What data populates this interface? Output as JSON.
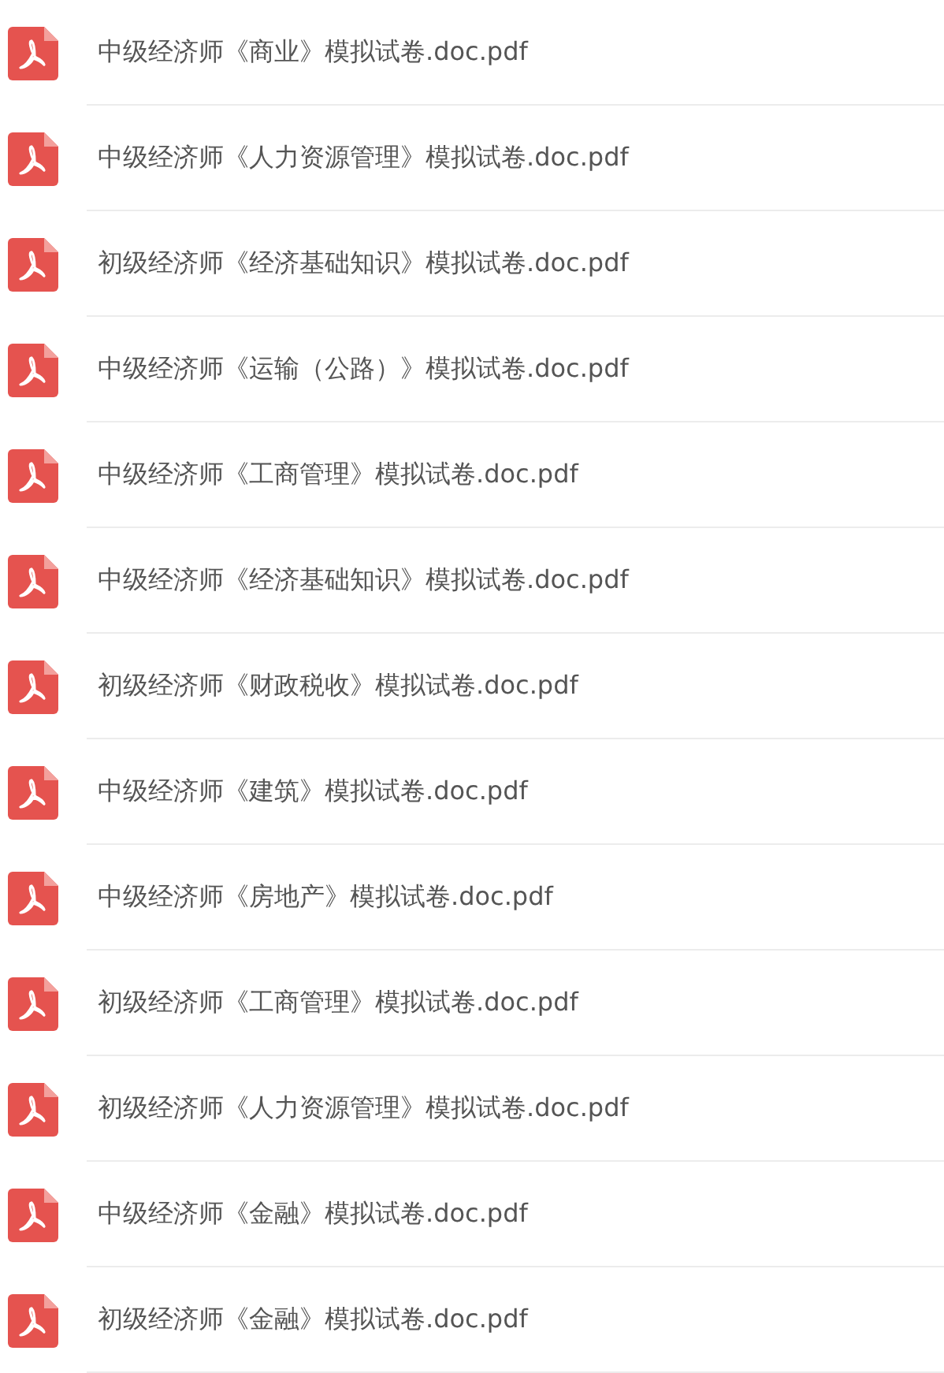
{
  "files": [
    {
      "name": "中级经济师《商业》模拟试卷.doc.pdf"
    },
    {
      "name": "中级经济师《人力资源管理》模拟试卷.doc.pdf"
    },
    {
      "name": "初级经济师《经济基础知识》模拟试卷.doc.pdf"
    },
    {
      "name": "中级经济师《运输（公路）》模拟试卷.doc.pdf"
    },
    {
      "name": "中级经济师《工商管理》模拟试卷.doc.pdf"
    },
    {
      "name": "中级经济师《经济基础知识》模拟试卷.doc.pdf"
    },
    {
      "name": "初级经济师《财政税收》模拟试卷.doc.pdf"
    },
    {
      "name": "中级经济师《建筑》模拟试卷.doc.pdf"
    },
    {
      "name": "中级经济师《房地产》模拟试卷.doc.pdf"
    },
    {
      "name": "初级经济师《工商管理》模拟试卷.doc.pdf"
    },
    {
      "name": "初级经济师《人力资源管理》模拟试卷.doc.pdf"
    },
    {
      "name": "中级经济师《金融》模拟试卷.doc.pdf"
    },
    {
      "name": "初级经济师《金融》模拟试卷.doc.pdf"
    }
  ]
}
